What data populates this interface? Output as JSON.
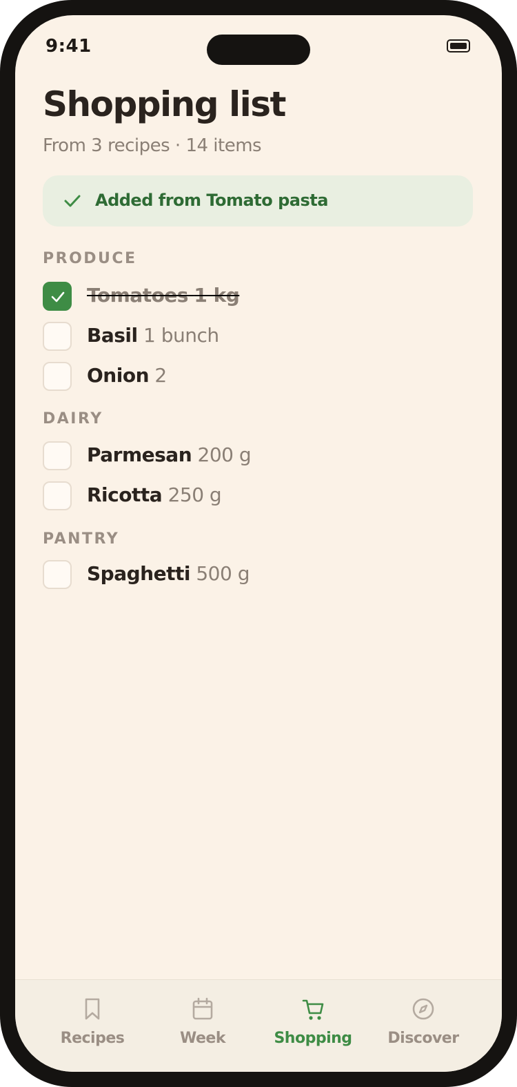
{
  "status": {
    "time": "9:41"
  },
  "header": {
    "title": "Shopping list",
    "subtitle": "From 3 recipes · 14 items"
  },
  "toast": {
    "text": "Added from Tomato pasta",
    "icon": "check-icon"
  },
  "sections": [
    {
      "label": "PRODUCE",
      "items": [
        {
          "name": "Tomatoes",
          "qty": "1 kg",
          "checked": true
        },
        {
          "name": "Basil",
          "qty": "1 bunch",
          "checked": false
        },
        {
          "name": "Onion",
          "qty": "2",
          "checked": false
        }
      ]
    },
    {
      "label": "DAIRY",
      "items": [
        {
          "name": "Parmesan",
          "qty": "200 g",
          "checked": false
        },
        {
          "name": "Ricotta",
          "qty": "250 g",
          "checked": false
        }
      ]
    },
    {
      "label": "PANTRY",
      "items": [
        {
          "name": "Spaghetti",
          "qty": "500 g",
          "checked": false
        }
      ]
    }
  ],
  "tabs": [
    {
      "label": "Recipes",
      "icon": "bookmark-icon",
      "active": false
    },
    {
      "label": "Week",
      "icon": "calendar-icon",
      "active": false
    },
    {
      "label": "Shopping",
      "icon": "cart-icon",
      "active": true
    },
    {
      "label": "Discover",
      "icon": "compass-icon",
      "active": false
    }
  ],
  "colors": {
    "accent": "#3e8c45",
    "background": "#fbf2e7",
    "toast_bg": "#e9efe1",
    "text_primary": "#2a231e",
    "text_muted": "#8a7f75"
  }
}
